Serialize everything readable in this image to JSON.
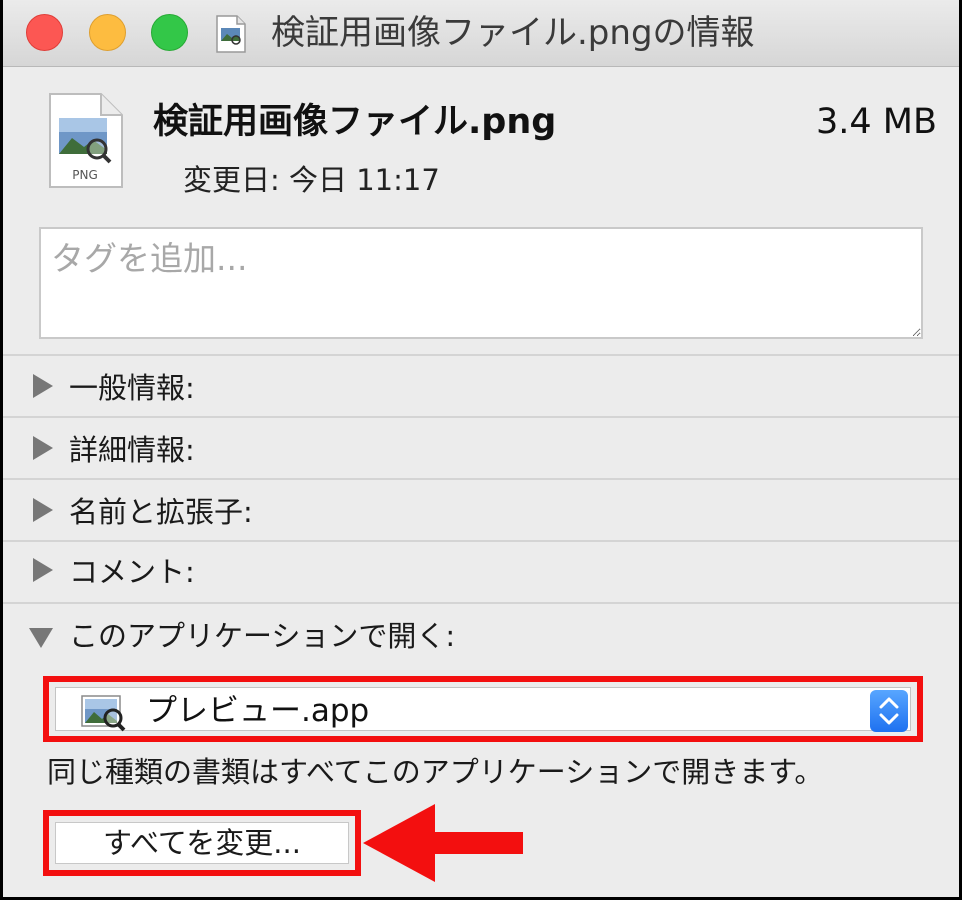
{
  "window": {
    "title": "検証用画像ファイル.pngの情報"
  },
  "header": {
    "file_icon_label": "PNG",
    "file_name": "検証用画像ファイル.png",
    "file_size": "3.4 MB",
    "modified_label": "変更日: 今日 11:17",
    "tag_placeholder": "タグを追加..."
  },
  "sections": [
    {
      "label": "一般情報:",
      "expanded": false
    },
    {
      "label": "詳細情報:",
      "expanded": false
    },
    {
      "label": "名前と拡張子:",
      "expanded": false
    },
    {
      "label": "コメント:",
      "expanded": false
    },
    {
      "label": "このアプリケーションで開く:",
      "expanded": true
    }
  ],
  "open_with": {
    "selected_app": "プレビュー.app",
    "note": "同じ種類の書類はすべてこのアプリケーションで開きます。",
    "change_all_label": "すべてを変更..."
  },
  "colors": {
    "highlight": "#f30f0f",
    "stepper": "#1e71f0"
  }
}
